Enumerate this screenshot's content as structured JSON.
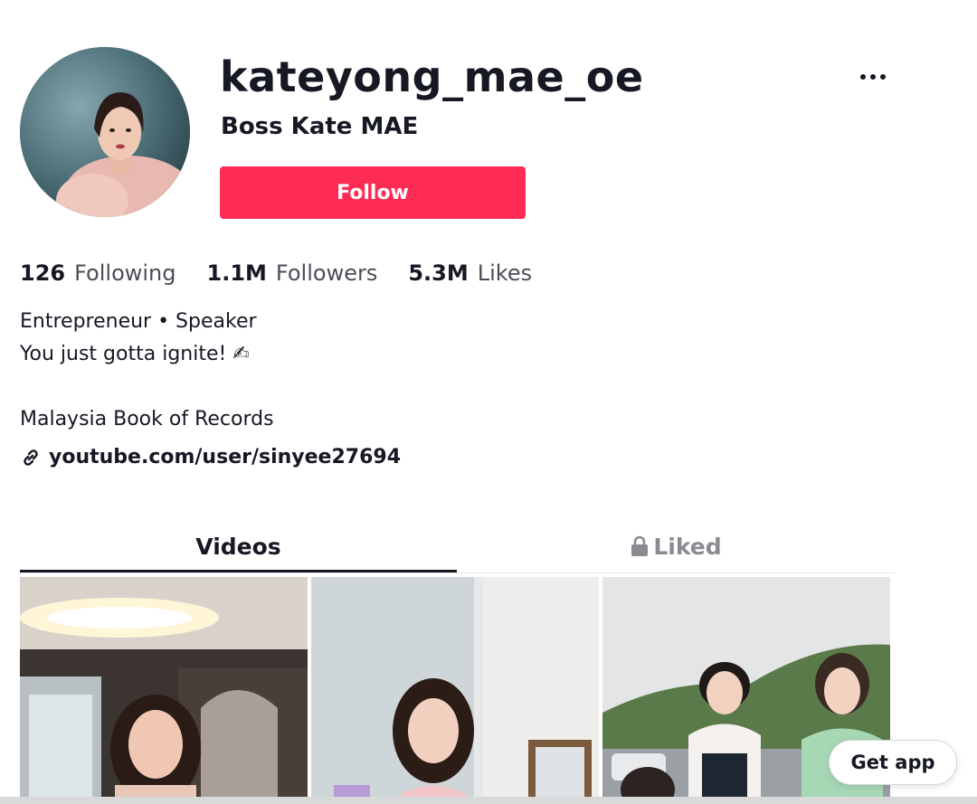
{
  "profile": {
    "username": "kateyong_mae_oe",
    "nickname": "Boss Kate MAE",
    "follow_label": "Follow"
  },
  "stats": [
    {
      "value": "126",
      "label": "Following"
    },
    {
      "value": "1.1M",
      "label": "Followers"
    },
    {
      "value": "5.3M",
      "label": "Likes"
    }
  ],
  "bio": {
    "line1": "Entrepreneur • Speaker",
    "line2": "You just gotta ignite! ✍",
    "line3": "Malaysia Book of Records"
  },
  "link": {
    "url": "youtube.com/user/sinyee27694",
    "icon": "link-icon"
  },
  "tabs": [
    {
      "label": "Videos",
      "active": true
    },
    {
      "label": "Liked",
      "active": false,
      "icon": "lock-icon"
    }
  ],
  "get_app_label": "Get app",
  "colors": {
    "accent": "#fe2c55",
    "text_primary": "#161823",
    "text_secondary": "#4b4d56",
    "inactive_tab": "#8a8b91"
  }
}
